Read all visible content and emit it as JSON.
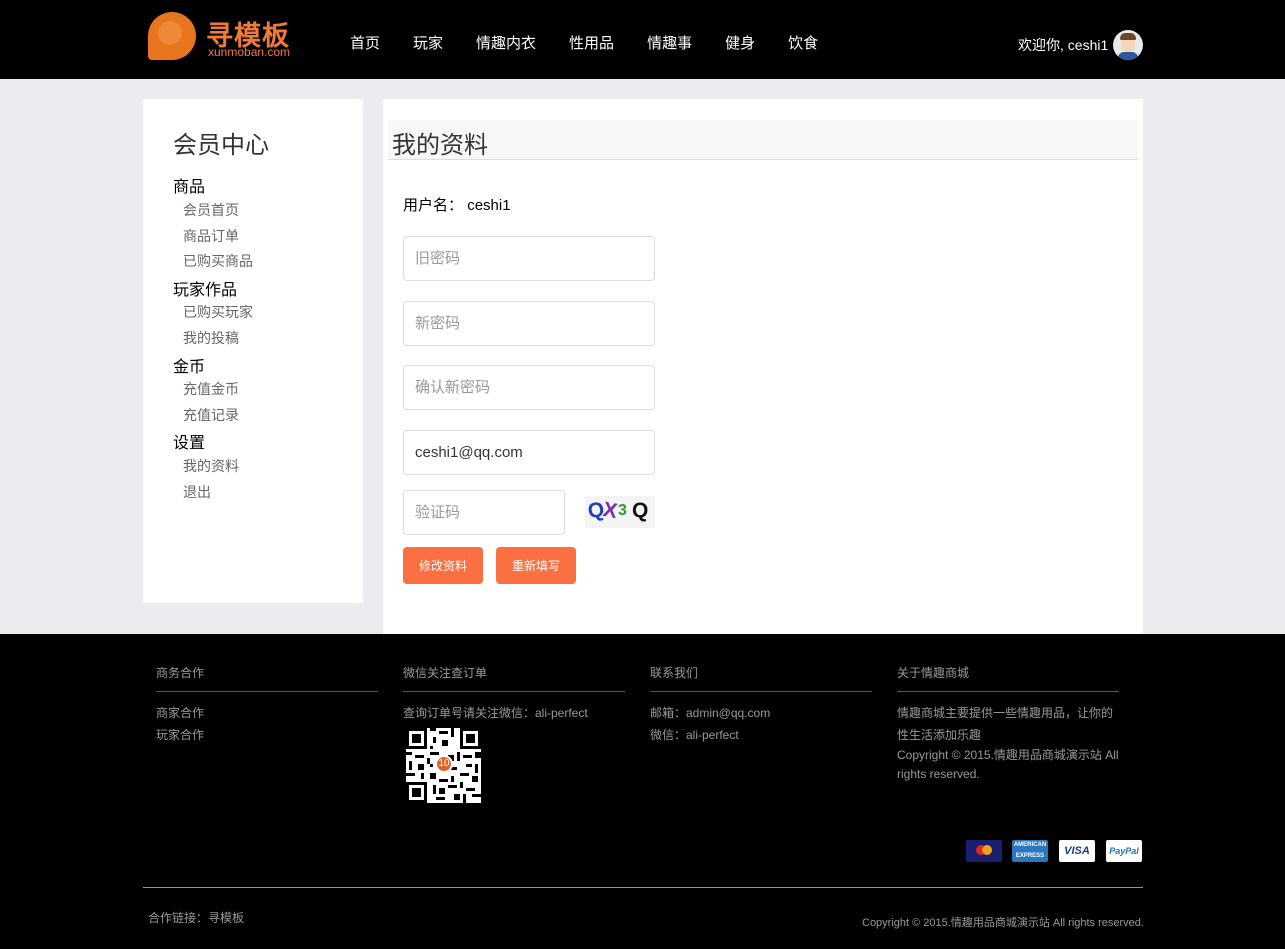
{
  "header": {
    "logo_title": "寻模板",
    "logo_subtitle": "xunmoban.com",
    "nav": [
      "首页",
      "玩家",
      "情趣内衣",
      "性用品",
      "情趣事",
      "健身",
      "饮食"
    ],
    "welcome": "欢迎你, ceshi1"
  },
  "sidebar": {
    "title": "会员中心",
    "groups": [
      {
        "label": "商品",
        "items": [
          "会员首页",
          "商品订单",
          "已购买商品"
        ]
      },
      {
        "label": "玩家作品",
        "items": [
          "已购买玩家",
          "我的投稿"
        ]
      },
      {
        "label": "金币",
        "items": [
          "充值金币",
          "充值记录"
        ]
      },
      {
        "label": "设置",
        "items": [
          "我的资料",
          "退出"
        ]
      }
    ]
  },
  "main": {
    "title": "我的资料",
    "username_label": "用户名：",
    "username_value": "ceshi1",
    "form": {
      "old_password_placeholder": "旧密码",
      "new_password_placeholder": "新密码",
      "confirm_password_placeholder": "确认新密码",
      "email_value": "ceshi1@qq.com",
      "captcha_placeholder": "验证码",
      "captcha_text": "QX3Q",
      "submit_label": "修改资料",
      "reset_label": "重新填写"
    }
  },
  "footer": {
    "columns": [
      {
        "title": "商务合作",
        "lines": [
          "商家合作",
          "玩家合作"
        ]
      },
      {
        "title": "微信关注查订单",
        "lines": [
          "查询订单号请关注微信：ali-perfect"
        ]
      },
      {
        "title": "联系我们",
        "lines": [
          "邮箱：admin@qq.com",
          "微信：ali-perfect"
        ]
      },
      {
        "title": "关于情趣商城",
        "lines": [
          "情趣商城主要提供一些情趣用品，让你的性生活添加乐趣",
          "Copyright © 2015.情趣用品商城演示站 All rights reserved."
        ]
      }
    ],
    "qr_badge": "10",
    "payment_methods": [
      "MasterCard",
      "AMERICAN EXPRESS",
      "VISA",
      "PayPal"
    ],
    "links": "合作链接：寻模板",
    "copyright": "Copyright © 2015.情趣用品商城演示站 All rights reserved."
  },
  "colors": {
    "accent": "#fa7040",
    "header_bg": "#000000",
    "page_bg": "#ececf0"
  }
}
